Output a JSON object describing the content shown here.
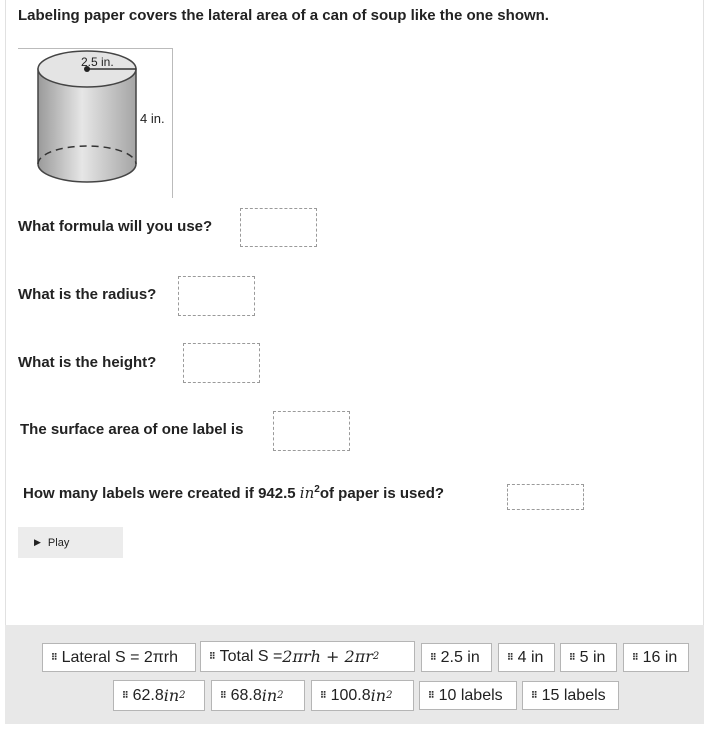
{
  "title": "Labeling paper covers the lateral area of a can of soup like the one shown.",
  "figure": {
    "radius_label": "2.5 in.",
    "height_label": "4 in."
  },
  "questions": [
    {
      "text": "What formula will you use?"
    },
    {
      "text": "What is the radius?"
    },
    {
      "text": "What is the height?"
    },
    {
      "text": "The surface area of one label is"
    },
    {
      "pre": "How many labels were created if 942.5 ",
      "unit": "in",
      "exp": "2",
      "post": "of paper is used?"
    }
  ],
  "play_label": "Play",
  "tiles": {
    "lateral": {
      "prefix": "Lateral S = 2πrh"
    },
    "total": {
      "prefix": "Total S = ",
      "formula": "2πrh + 2πr",
      "exp": "2"
    },
    "t25": {
      "label": "2.5 in"
    },
    "t4": {
      "label": "4 in"
    },
    "t5": {
      "label": "5 in"
    },
    "t16": {
      "label": "16 in"
    },
    "t628": {
      "num": "62.8 ",
      "unit": "in",
      "exp": "2"
    },
    "t688": {
      "num": "68.8 ",
      "unit": "in",
      "exp": "2"
    },
    "t1008": {
      "num": "100.8 ",
      "unit": "in",
      "exp": "2"
    },
    "t10": {
      "label": "10 labels"
    },
    "t15": {
      "label": "15 labels"
    }
  }
}
